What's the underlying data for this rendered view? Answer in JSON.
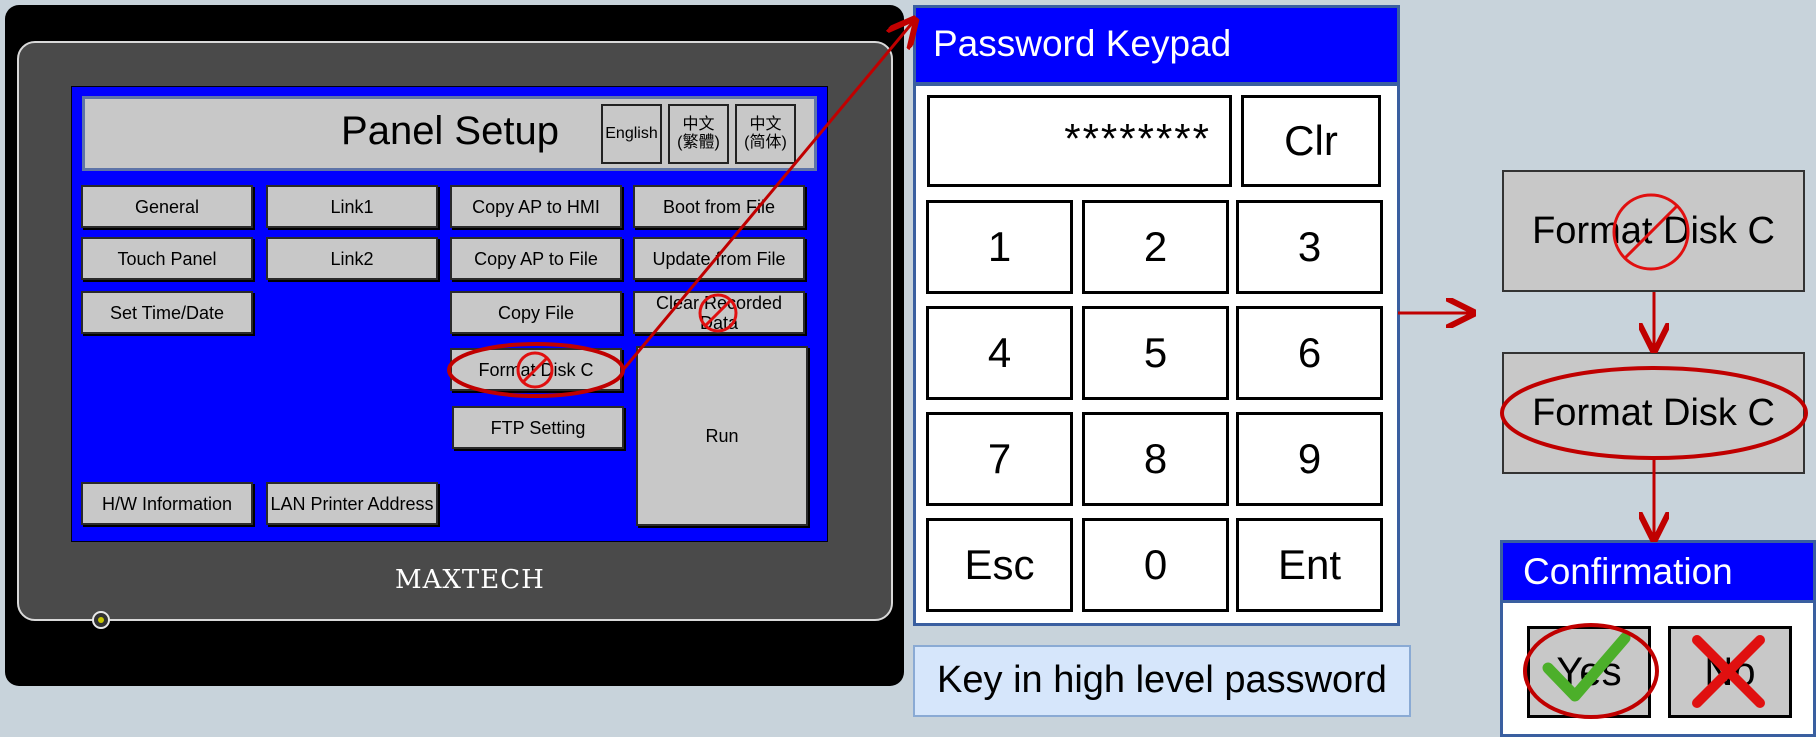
{
  "panel": {
    "title": "Panel Setup",
    "languages": [
      {
        "l1": "English",
        "l2": ""
      },
      {
        "l1": "中文",
        "l2": "(繁體)"
      },
      {
        "l1": "中文",
        "l2": "(简体)"
      }
    ],
    "buttons": {
      "general": "General",
      "link1": "Link1",
      "copy_ap_hmi": "Copy AP to HMI",
      "boot_from_file": "Boot from File",
      "touch_panel": "Touch Panel",
      "link2": "Link2",
      "copy_ap_file": "Copy AP to File",
      "update_from_file": "Update from File",
      "set_time": "Set Time/Date",
      "copy_file": "Copy File",
      "clear_recorded": "Clear Recorded Data",
      "format_disk": "Format Disk C",
      "ftp_setting": "FTP Setting",
      "run": "Run",
      "hw_info": "H/W Information",
      "lan_printer": "LAN Printer Address"
    },
    "brand": "MAXTECH"
  },
  "keypad": {
    "title": "Password Keypad",
    "display": "********",
    "clear": "Clr",
    "keys": [
      "1",
      "2",
      "3",
      "4",
      "5",
      "6",
      "7",
      "8",
      "9",
      "Esc",
      "0",
      "Ent"
    ],
    "hint": "Key in high level password"
  },
  "flow": {
    "step1": "Format Disk C",
    "step2": "Format Disk C",
    "confirm_title": "Confirmation",
    "yes": "Yes",
    "no": "No"
  },
  "colors": {
    "screen_blue": "#0000ff",
    "button_gray": "#c8c8c8",
    "annotation_red": "#c00000",
    "check_green": "#4caf2a"
  }
}
